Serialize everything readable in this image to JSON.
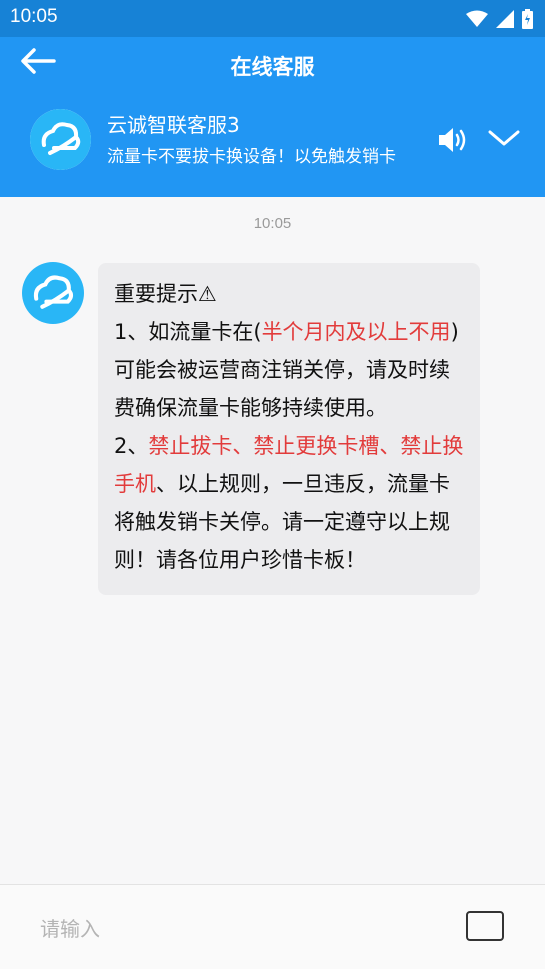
{
  "status_bar": {
    "time": "10:05"
  },
  "app_bar": {
    "title": "在线客服"
  },
  "agent": {
    "name": "云诚智联客服3",
    "subtitle": "流量卡不要拔卡换设备！以免触发销卡"
  },
  "chat": {
    "timestamp": "10:05",
    "message": {
      "heading": "重要提示⚠",
      "p1_a": "1、如流量卡在(",
      "p1_red": "半个月内及以上不用",
      "p1_b": ")可能会被运营商注销关停，请及时续费确保流量卡能够持续使用。",
      "p2_a": "2、",
      "p2_red": "禁止拔卡、禁止更换卡槽、禁止换手机",
      "p2_b": "、以上规则，一旦违反，流量卡将触发销卡关停。请一定遵守以上规则！请各位用户珍惜卡板！"
    }
  },
  "input": {
    "placeholder": "请输入"
  },
  "colors": {
    "primary": "#2196f3",
    "status_bar": "#1782d6",
    "highlight": "#e23b3b"
  }
}
